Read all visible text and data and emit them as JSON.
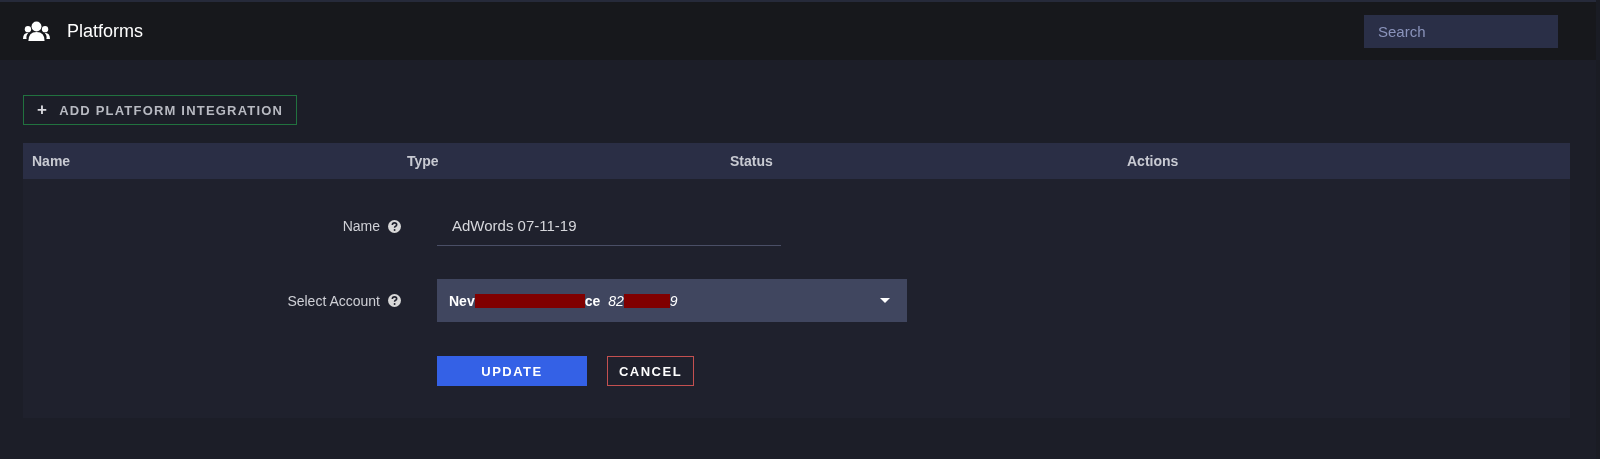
{
  "header": {
    "title": "Platforms",
    "search": {
      "placeholder": "Search"
    }
  },
  "add_button": {
    "icon": "+",
    "label": "ADD PLATFORM INTEGRATION"
  },
  "table": {
    "columns": [
      "Name",
      "Type",
      "Status",
      "Actions"
    ]
  },
  "form": {
    "name": {
      "label": "Name",
      "value": "AdWords 07-11-19"
    },
    "account": {
      "label": "Select Account",
      "segments": [
        {
          "kind": "text",
          "text": "Nev"
        },
        {
          "kind": "redacted-long"
        },
        {
          "kind": "text",
          "text": "ce"
        },
        {
          "kind": "number",
          "text": "82"
        },
        {
          "kind": "redacted-short"
        },
        {
          "kind": "number",
          "text": "9"
        }
      ]
    },
    "buttons": [
      {
        "kind": "primary",
        "label": "UPDATE"
      },
      {
        "kind": "outline",
        "label": "CANCEL"
      }
    ]
  }
}
